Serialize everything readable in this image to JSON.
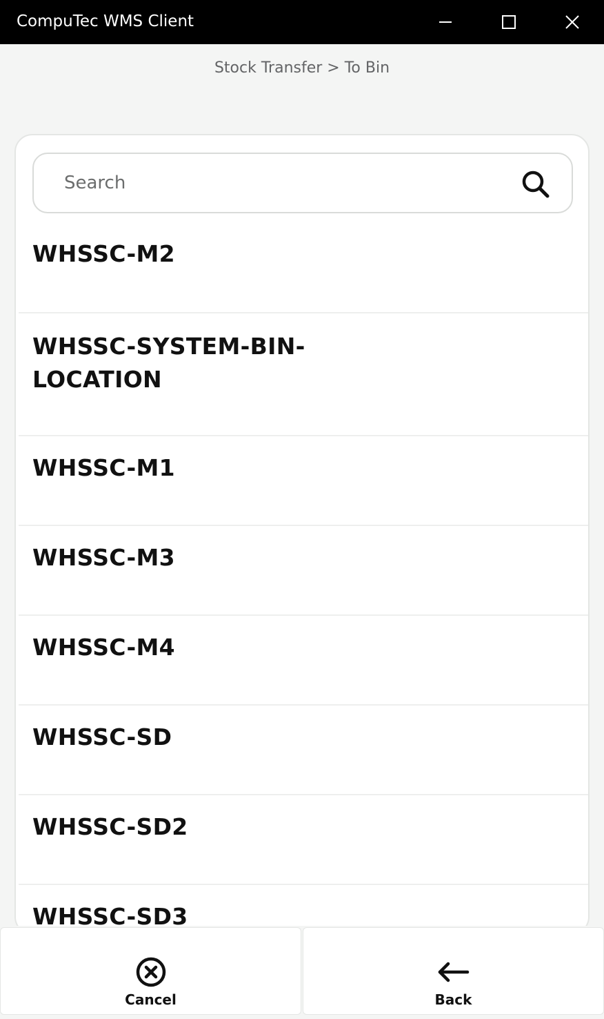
{
  "window": {
    "title": "CompuTec WMS Client"
  },
  "header": {
    "breadcrumb": "Stock Transfer > To Bin"
  },
  "search": {
    "placeholder": "Search",
    "value": ""
  },
  "bins": [
    {
      "label": "WHSSC-M2"
    },
    {
      "label": "WHSSC-SYSTEM-BIN-LOCATION"
    },
    {
      "label": "WHSSC-M1"
    },
    {
      "label": "WHSSC-M3"
    },
    {
      "label": "WHSSC-M4"
    },
    {
      "label": "WHSSC-SD"
    },
    {
      "label": "WHSSC-SD2"
    },
    {
      "label": "WHSSC-SD3"
    }
  ],
  "footer": {
    "cancel_label": "Cancel",
    "back_label": "Back"
  },
  "icons": {
    "minimize": "minimize-icon",
    "maximize": "maximize-icon",
    "close": "close-icon",
    "search": "search-icon",
    "cancel": "cancel-circle-icon",
    "back": "arrow-left-icon"
  }
}
